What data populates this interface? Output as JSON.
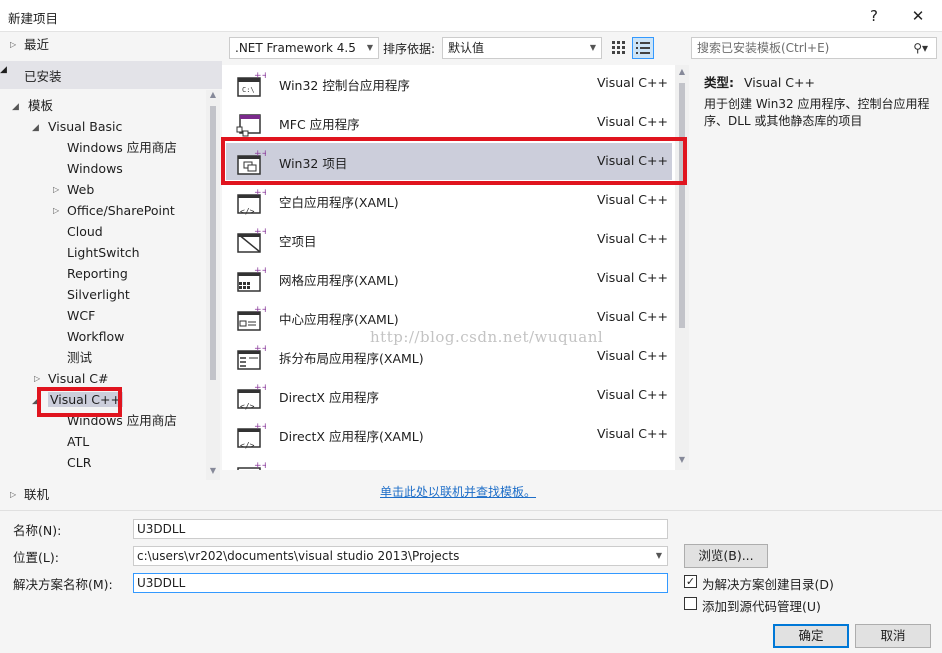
{
  "window": {
    "title": "新建项目",
    "help_label": "?",
    "close_label": "✕"
  },
  "tree": {
    "recent": "最近",
    "installed": "已安装",
    "templates": "模板",
    "visual_basic": "Visual Basic",
    "vb_items": [
      "Windows 应用商店",
      "Windows",
      "Web",
      "Office/SharePoint",
      "Cloud",
      "LightSwitch",
      "Reporting",
      "Silverlight",
      "WCF",
      "Workflow",
      "测试"
    ],
    "visual_csharp": "Visual C#",
    "visual_cpp": "Visual C++",
    "cpp_items": [
      "Windows 应用商店",
      "ATL",
      "CLR"
    ],
    "online": "联机"
  },
  "toolbar": {
    "framework": ".NET Framework 4.5",
    "sort_label": "排序依据:",
    "sort_value": "默认值",
    "search_placeholder": "搜索已安装模板(Ctrl+E)"
  },
  "templates": [
    {
      "name": "Win32 控制台应用程序",
      "lang": "Visual C++",
      "icon": "console-app-icon"
    },
    {
      "name": "MFC 应用程序",
      "lang": "Visual C++",
      "icon": "mfc-app-icon"
    },
    {
      "name": "Win32 项目",
      "lang": "Visual C++",
      "icon": "win32-project-icon",
      "selected": true
    },
    {
      "name": "空白应用程序(XAML)",
      "lang": "Visual C++",
      "icon": "blank-xaml-app-icon"
    },
    {
      "name": "空项目",
      "lang": "Visual C++",
      "icon": "empty-project-icon"
    },
    {
      "name": "网格应用程序(XAML)",
      "lang": "Visual C++",
      "icon": "grid-xaml-app-icon"
    },
    {
      "name": "中心应用程序(XAML)",
      "lang": "Visual C++",
      "icon": "hub-xaml-app-icon"
    },
    {
      "name": "拆分布局应用程序(XAML)",
      "lang": "Visual C++",
      "icon": "split-xaml-app-icon"
    },
    {
      "name": "DirectX 应用程序",
      "lang": "Visual C++",
      "icon": "directx-app-icon"
    },
    {
      "name": "DirectX 应用程序(XAML)",
      "lang": "Visual C++",
      "icon": "directx-xaml-app-icon"
    }
  ],
  "details": {
    "type_label": "类型:",
    "type_value": "Visual C++",
    "description": "用于创建 Win32 应用程序、控制台应用程序、DLL 或其他静态库的项目"
  },
  "online_link": "单击此处以联机并查找模板。",
  "watermark": "http://blog.csdn.net/wuquanl",
  "form": {
    "name_label": "名称(N):",
    "name_value": "U3DDLL",
    "location_label": "位置(L):",
    "location_value": "c:\\users\\vr202\\documents\\visual studio 2013\\Projects",
    "solution_label": "解决方案名称(M):",
    "solution_value": "U3DDLL",
    "browse_label": "浏览(B)...",
    "create_dir_label": "为解决方案创建目录(D)",
    "create_dir_checked": true,
    "source_control_label": "添加到源代码管理(U)",
    "source_control_checked": false,
    "ok_label": "确定",
    "cancel_label": "取消"
  },
  "colors": {
    "highlight": "#e0141e",
    "selection": "#cccedb",
    "link": "#1e6ec8"
  }
}
